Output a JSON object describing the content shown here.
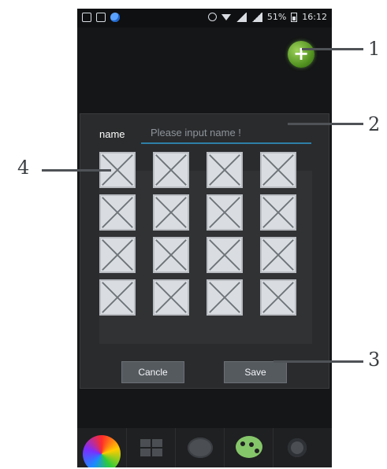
{
  "status_bar": {
    "battery_text": "51%",
    "time": "16:12",
    "icons": [
      "image-icon",
      "picture-icon",
      "globe-icon",
      "alarm-icon",
      "wifi-icon",
      "signal-icon",
      "signal-icon",
      "battery-icon"
    ]
  },
  "add_button": {
    "icon": "plus-icon",
    "label": "+"
  },
  "dialog": {
    "name_label": "name",
    "name_placeholder": "Please input name !",
    "grid_rows": 4,
    "grid_cols": 4,
    "cell_icon": "broken-image-icon",
    "buttons": {
      "cancle": "Cancle",
      "save": "Save"
    }
  },
  "dock": {
    "items": [
      {
        "name": "color-wheel-icon"
      },
      {
        "name": "grid-icon"
      },
      {
        "name": "palette-icon"
      },
      {
        "name": "palette-green-icon"
      },
      {
        "name": "gear-icon"
      }
    ]
  },
  "annotations": {
    "items": [
      {
        "number": "1"
      },
      {
        "number": "2"
      },
      {
        "number": "3"
      },
      {
        "number": "4"
      }
    ]
  }
}
